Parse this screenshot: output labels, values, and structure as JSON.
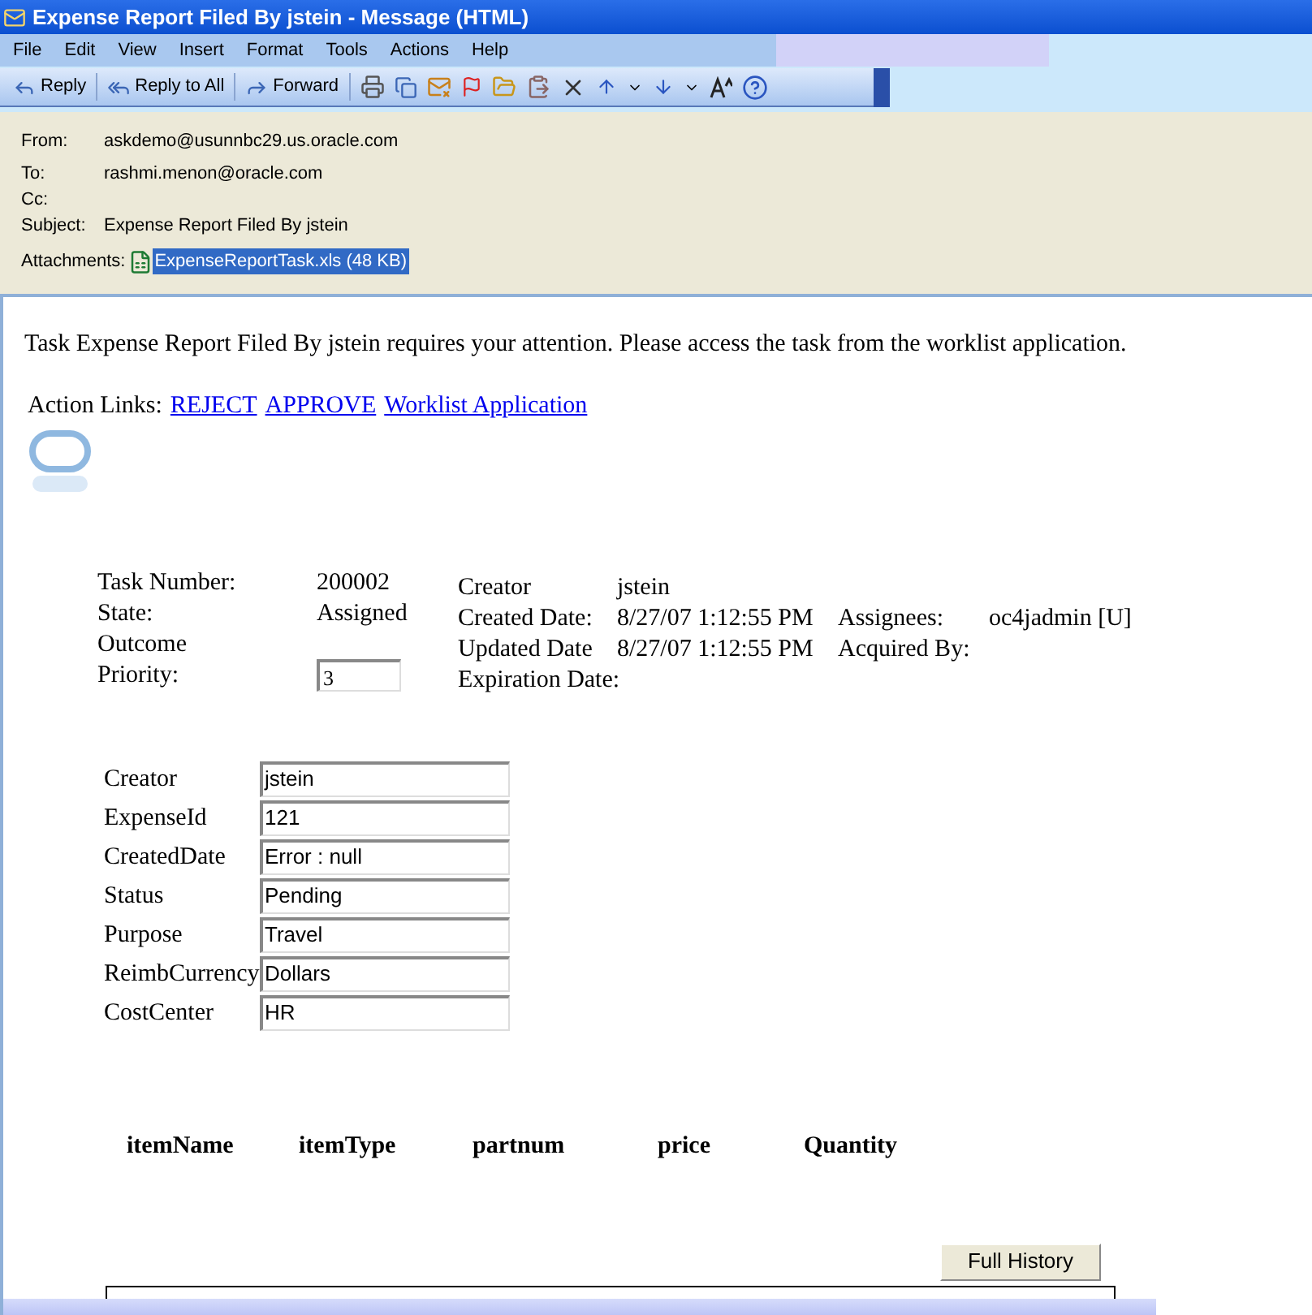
{
  "window": {
    "title": "Expense Report Filed By jstein - Message (HTML)"
  },
  "menu": [
    "File",
    "Edit",
    "View",
    "Insert",
    "Format",
    "Tools",
    "Actions",
    "Help"
  ],
  "toolbar": [
    "Reply",
    "Reply to All",
    "Forward"
  ],
  "header": {
    "fields": [
      {
        "label": "From:",
        "value": "askdemo@usunnbc29.us.oracle.com"
      },
      {
        "label": "To:",
        "value": "rashmi.menon@oracle.com"
      },
      {
        "label": "Cc:"
      },
      {
        "label": "Subject:",
        "value": "Expense Report Filed By jstein"
      }
    ],
    "attachments_label": "Attachments:",
    "attachment": {
      "name": "ExpenseReportTask.xls (48 KB)",
      "selected": true
    }
  },
  "body": {
    "intro": "Task Expense Report Filed By jstein requires your attention. Please access the task from the worklist application.",
    "action_label": "Action Links:",
    "links": [
      "REJECT",
      "APPROVE",
      "Worklist Application"
    ],
    "task": [
      {
        "label": "Task Number:",
        "value": "200002"
      },
      {
        "label": "State:",
        "value": "Assigned"
      },
      {
        "label": "Outcome"
      },
      {
        "label": "Priority:",
        "value": "3",
        "kind": "field"
      }
    ],
    "task_right": [
      {
        "label": "Creator",
        "value": "jstein"
      },
      {
        "label": "Created Date:",
        "value": "8/27/07 1:12:55 PM",
        "extra_label": "Assignees:",
        "extra_value": "oc4jadmin [U]"
      },
      {
        "label": "Updated Date",
        "value": "8/27/07 1:12:55 PM",
        "extra_label": "Acquired By:"
      },
      {
        "label": "Expiration Date:"
      }
    ],
    "payload": [
      {
        "label": "Creator",
        "value": "jstein"
      },
      {
        "label": "ExpenseId",
        "value": "121"
      },
      {
        "label": "CreatedDate",
        "value": "Error : null"
      },
      {
        "label": "Status",
        "value": "Pending"
      },
      {
        "label": "Purpose",
        "value": "Travel"
      },
      {
        "label": "ReimbCurrency",
        "value": "Dollars"
      },
      {
        "label": "CostCenter",
        "value": "HR"
      }
    ],
    "table": {
      "columns": [
        "itemName",
        "itemType",
        "partnum",
        "price",
        "Quantity"
      ]
    },
    "history_button": "Full History"
  }
}
